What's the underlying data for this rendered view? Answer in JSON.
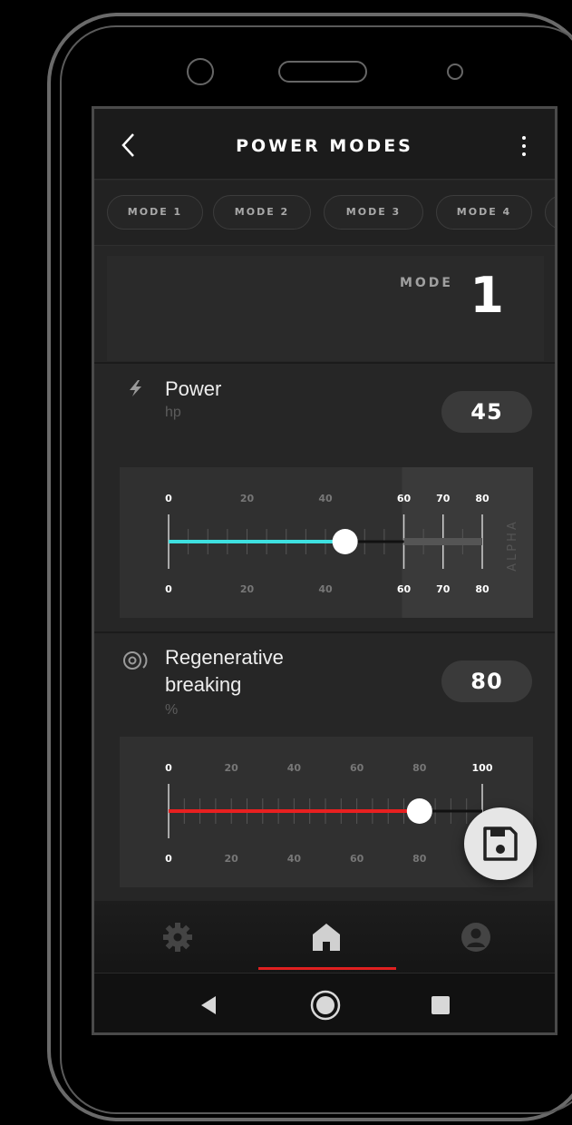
{
  "header": {
    "title": "POWER MODES",
    "back_icon": "chevron-left-icon",
    "menu_icon": "more-vertical-icon"
  },
  "tabs": [
    {
      "label": "MODE 1"
    },
    {
      "label": "MODE 2"
    },
    {
      "label": "MODE 3"
    },
    {
      "label": "MODE 4"
    }
  ],
  "mode_card": {
    "label": "MODE",
    "number": "1"
  },
  "power": {
    "title": "Power",
    "unit": "hp",
    "value": "45",
    "icon": "lightning-icon",
    "slider": {
      "top_ticks": [
        "0",
        "20",
        "40",
        "60",
        "70",
        "80"
      ],
      "bottom_ticks": [
        "0",
        "20",
        "40",
        "60",
        "70",
        "80"
      ],
      "side_label": "ALPHA",
      "value": 45,
      "max": 80,
      "color": "#3ee0e0"
    }
  },
  "regen": {
    "title_line1": "Regenerative",
    "title_line2": "breaking",
    "unit": "%",
    "value": "80",
    "icon": "regen-brake-icon",
    "slider": {
      "top_ticks": [
        "0",
        "20",
        "40",
        "60",
        "80",
        "100"
      ],
      "bottom_ticks": [
        "0",
        "20",
        "40",
        "60",
        "80"
      ],
      "value": 80,
      "max": 100,
      "color": "#e82020"
    }
  },
  "save_button_icon": "save-icon",
  "bottom_nav": [
    {
      "name": "settings",
      "icon": "gear-icon"
    },
    {
      "name": "home",
      "icon": "home-icon",
      "active": true
    },
    {
      "name": "profile",
      "icon": "user-icon"
    }
  ],
  "accent_color": "#e02020"
}
